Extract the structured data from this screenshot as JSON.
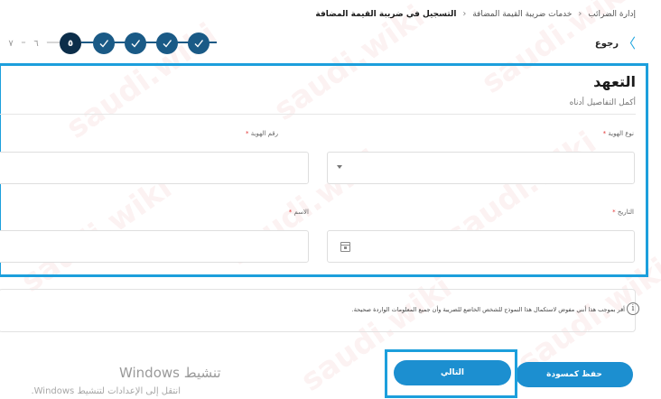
{
  "breadcrumb": {
    "items": [
      "إدارة الضرائب",
      "خدمات ضريبة القيمة المضافة",
      "التسجيل في ضريبة القيمة المضافة"
    ],
    "separator": "‹"
  },
  "back": {
    "label": "رجوع",
    "icon": "chevron-right-icon"
  },
  "stepper": {
    "steps": [
      {
        "label": "٧",
        "state": "pending"
      },
      {
        "label": "٦",
        "state": "pending"
      },
      {
        "label": "٥",
        "state": "current"
      },
      {
        "label": "",
        "state": "done"
      },
      {
        "label": "",
        "state": "done"
      },
      {
        "label": "",
        "state": "done"
      },
      {
        "label": "",
        "state": "done"
      }
    ]
  },
  "form": {
    "title": "التعهد",
    "subtitle": "أكمل التفاصيل أدناه",
    "fields": {
      "id_type": {
        "label": "نوع الهوية",
        "required": "*",
        "value": ""
      },
      "id_number": {
        "label": "رقم الهوية",
        "required": "*",
        "value": ""
      },
      "date": {
        "label": "التاريخ",
        "required": "*",
        "value": ""
      },
      "name": {
        "label": "الاسم",
        "required": "*",
        "value": ""
      }
    }
  },
  "declaration": {
    "text": "أقر بموجب هذا أنني مفوض لاستكمال هذا النموذج للشخص الخاضع للضريبة وأن جميع المعلومات الواردة صحيحة.",
    "icon": "info-icon"
  },
  "buttons": {
    "save_draft": "حفظ كمسودة",
    "next": "التالي"
  },
  "windows_activation": {
    "title": "تنشيط Windows",
    "subtitle": "انتقل إلى الإعدادات لتنشيط Windows."
  },
  "watermark": {
    "text": "saudi.wiki"
  },
  "colors": {
    "accent": "#1c8fd0",
    "highlight": "#1c9fdc",
    "step_done": "#1a5a86",
    "step_current": "#0c2e4a",
    "required": "#e23636"
  }
}
